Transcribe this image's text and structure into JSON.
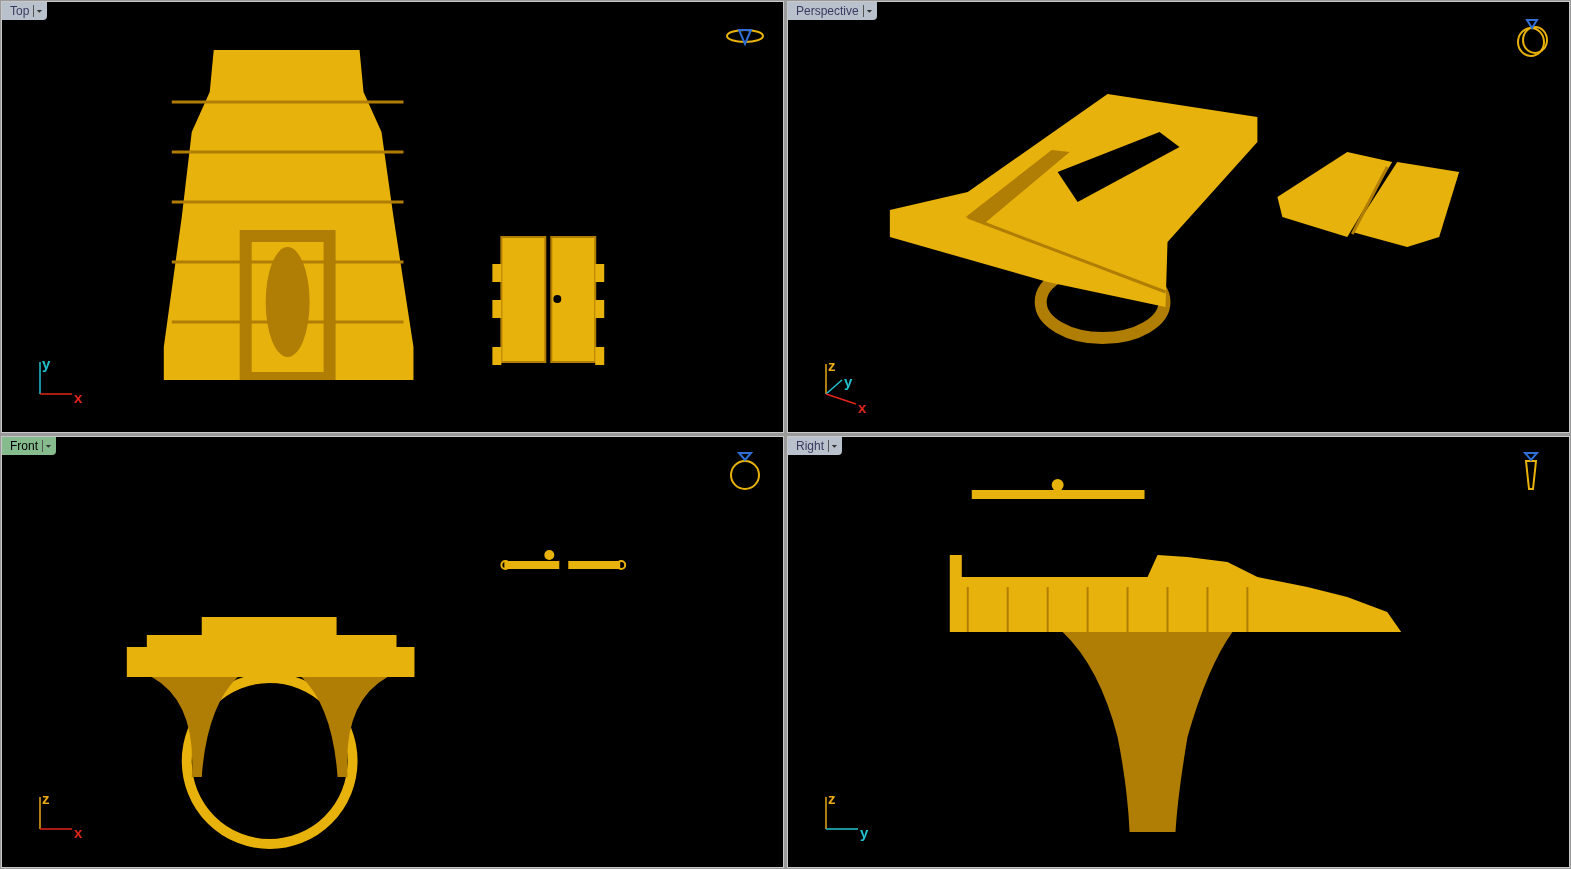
{
  "viewports": [
    {
      "title": "Top",
      "selected": false,
      "kind": "top",
      "axes": [
        {
          "label": "y",
          "color": "#22c3d0"
        },
        {
          "label": "x",
          "color": "#e0241c"
        }
      ]
    },
    {
      "title": "Perspective",
      "selected": false,
      "kind": "perspective",
      "axes": [
        {
          "label": "z",
          "color": "#e8a81a"
        },
        {
          "label": "y",
          "color": "#22c3d0"
        },
        {
          "label": "x",
          "color": "#e0241c"
        }
      ]
    },
    {
      "title": "Front",
      "selected": true,
      "kind": "front",
      "axes": [
        {
          "label": "z",
          "color": "#e8a81a"
        },
        {
          "label": "x",
          "color": "#e0241c"
        }
      ]
    },
    {
      "title": "Right",
      "selected": false,
      "kind": "right",
      "axes": [
        {
          "label": "z",
          "color": "#e8a81a"
        },
        {
          "label": "y",
          "color": "#22c3d0"
        }
      ]
    }
  ]
}
